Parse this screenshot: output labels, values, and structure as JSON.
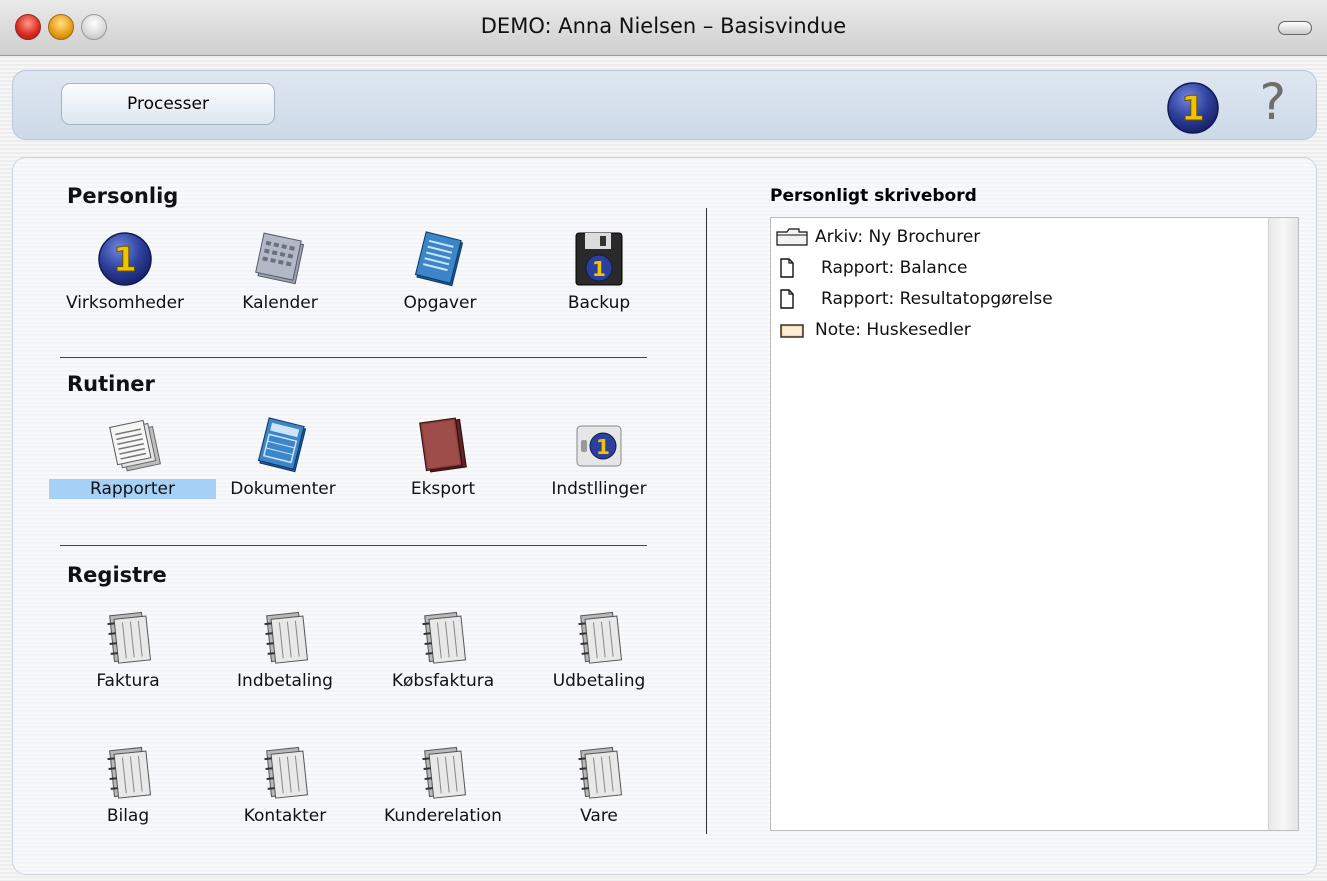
{
  "window": {
    "title": "DEMO: Anna Nielsen – Basisvindue"
  },
  "toolbar": {
    "processer_label": "Processer",
    "help_glyph": "?"
  },
  "sections": {
    "personlig": "Personlig",
    "rutiner": "Rutiner",
    "registre": "Registre"
  },
  "personlig_items": [
    {
      "label": "Virksomheder",
      "icon": "company-logo-icon"
    },
    {
      "label": "Kalender",
      "icon": "calendar-icon"
    },
    {
      "label": "Opgaver",
      "icon": "tasks-icon"
    },
    {
      "label": "Backup",
      "icon": "floppy-disk-icon"
    }
  ],
  "rutiner_items": [
    {
      "label": "Rapporter",
      "icon": "reports-icon",
      "selected": true
    },
    {
      "label": "Dokumenter",
      "icon": "documents-icon"
    },
    {
      "label": "Eksport",
      "icon": "export-book-icon"
    },
    {
      "label": "Indstllinger",
      "icon": "settings-icon"
    }
  ],
  "registre_items": [
    {
      "label": "Faktura",
      "icon": "register-icon"
    },
    {
      "label": "Indbetaling",
      "icon": "register-icon"
    },
    {
      "label": "Købsfaktura",
      "icon": "register-icon"
    },
    {
      "label": "Udbetaling",
      "icon": "register-icon"
    },
    {
      "label": "Bilag",
      "icon": "register-icon"
    },
    {
      "label": "Kontakter",
      "icon": "register-icon"
    },
    {
      "label": "Kunderelation",
      "icon": "register-icon"
    },
    {
      "label": "Vare",
      "icon": "register-icon"
    }
  ],
  "desk": {
    "title": "Personligt skrivebord",
    "items": [
      {
        "label": "Arkiv: Ny Brochurer",
        "icon": "folder-icon"
      },
      {
        "label": "Rapport: Balance",
        "icon": "document-icon"
      },
      {
        "label": "Rapport: Resultatopgørelse",
        "icon": "document-icon"
      },
      {
        "label": "Note: Huskesedler",
        "icon": "note-icon"
      }
    ]
  },
  "colors": {
    "selection": "#a7d0f7",
    "logo_blue": "#2c3f9a",
    "logo_yellow": "#f2c400"
  }
}
